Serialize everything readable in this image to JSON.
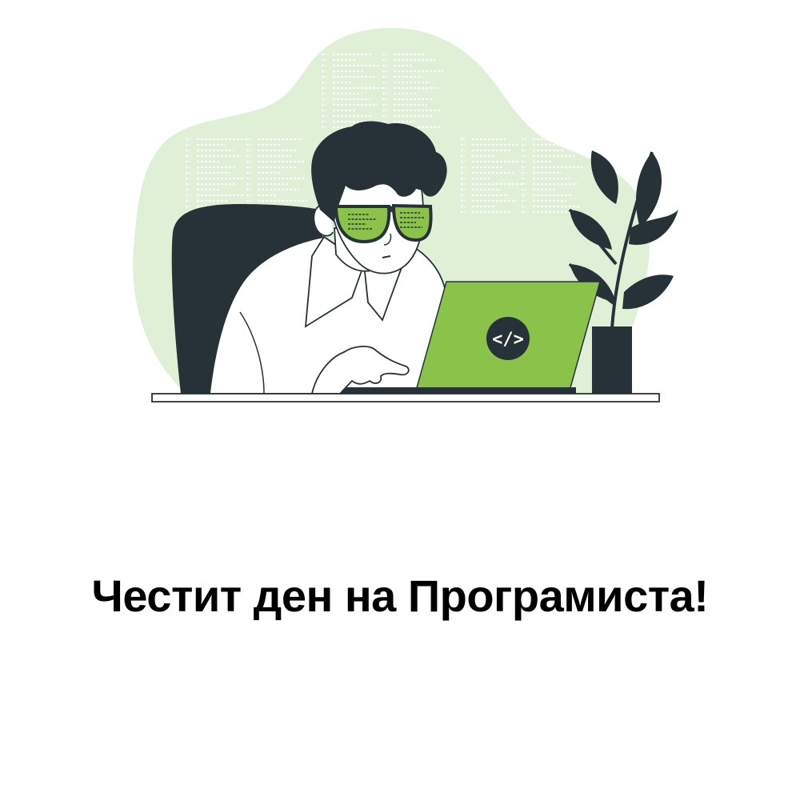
{
  "greeting": {
    "text": "Честит ден на Програмиста!"
  },
  "illustration": {
    "laptop_code_symbol": "</>",
    "colors": {
      "blob": "#dff0d6",
      "accent": "#8bc34a",
      "dark": "#263238",
      "code_lines": "#ffffff"
    },
    "icons": [
      "developer-figure",
      "laptop-icon",
      "plant-icon",
      "office-chair"
    ]
  }
}
